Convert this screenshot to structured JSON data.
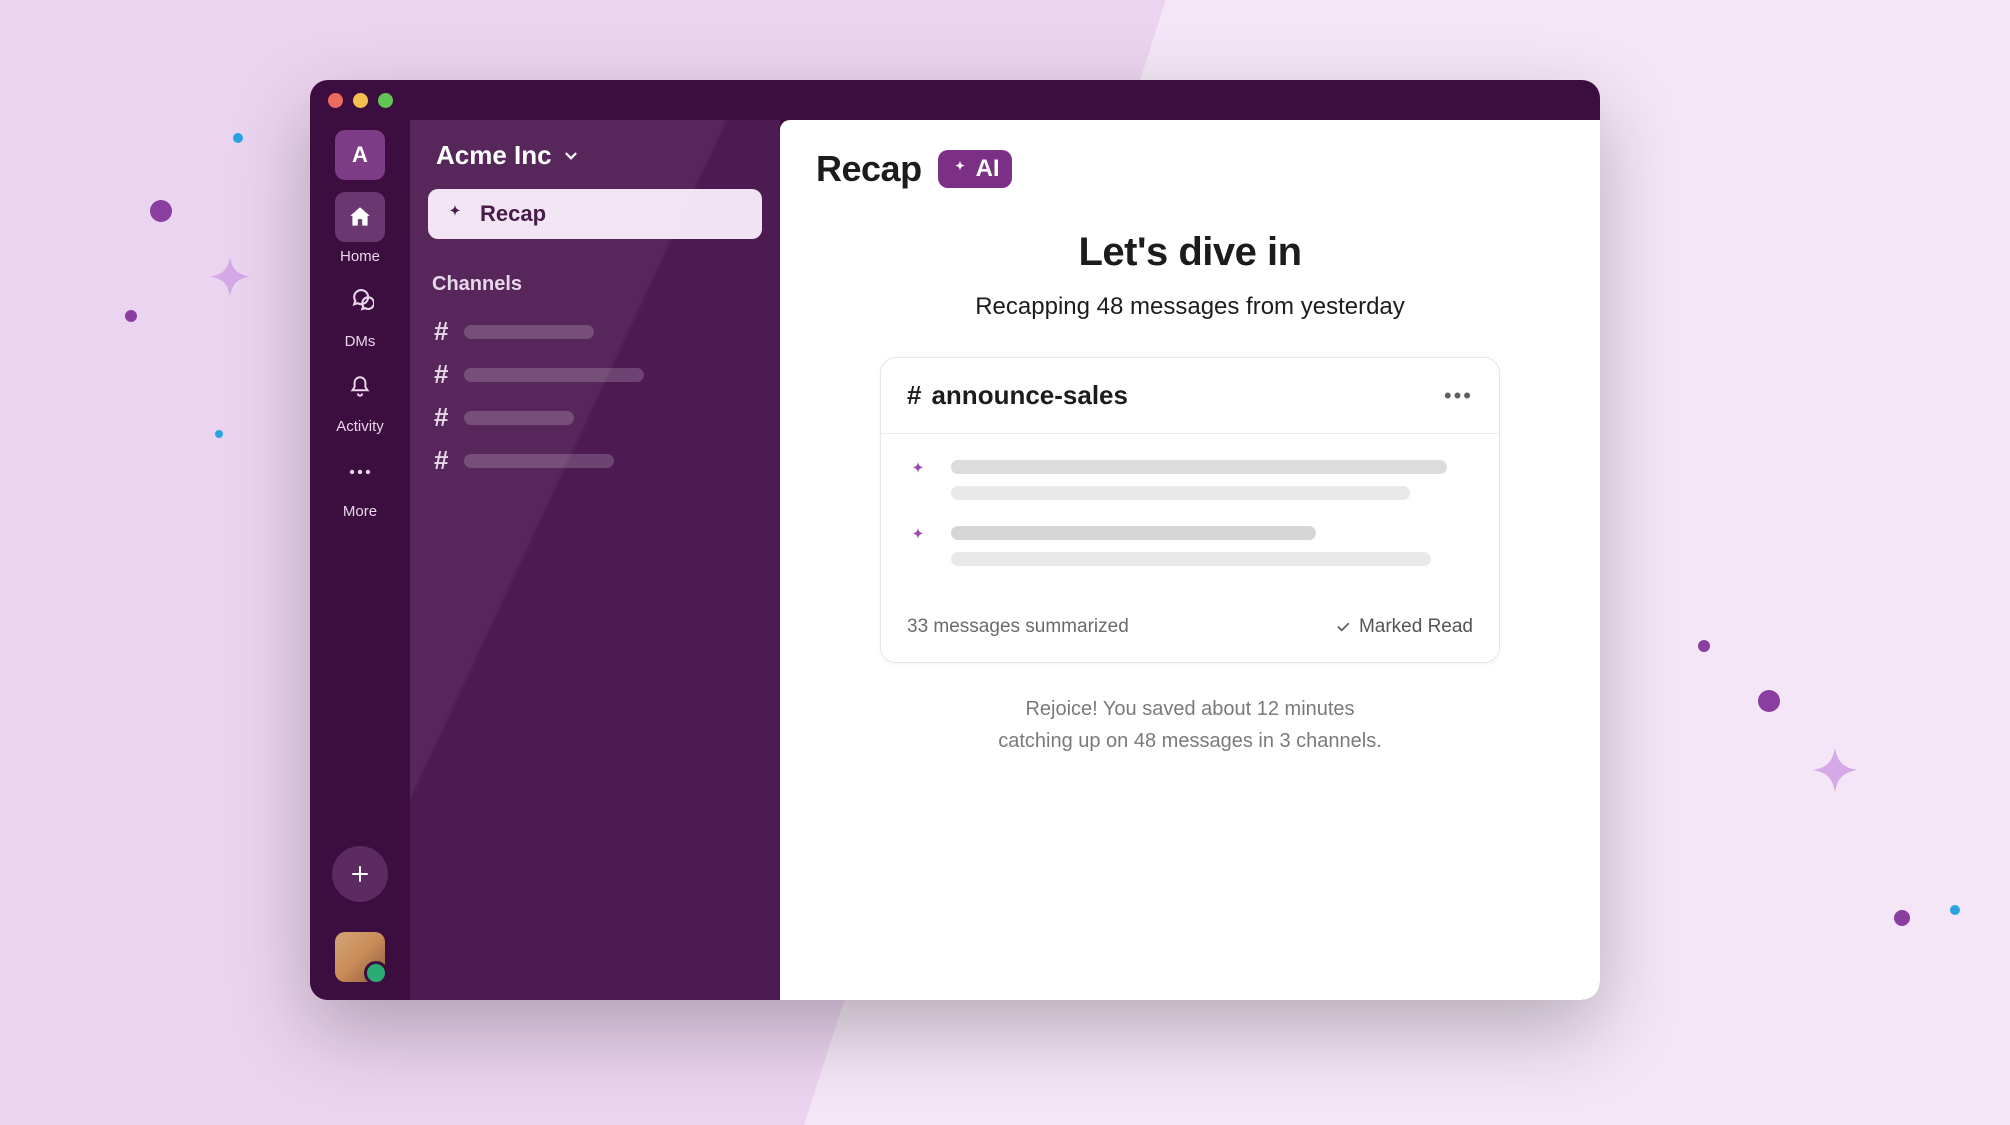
{
  "workspace": {
    "letter": "A",
    "name": "Acme Inc"
  },
  "rail": {
    "home": "Home",
    "dms": "DMs",
    "activity": "Activity",
    "more": "More"
  },
  "sidebar": {
    "recap_label": "Recap",
    "channels_header": "Channels"
  },
  "main": {
    "title": "Recap",
    "ai_badge": "AI",
    "hero_title": "Let's dive in",
    "hero_sub": "Recapping 48 messages from yesterday",
    "card": {
      "channel": "announce-sales",
      "summary_count": "33 messages summarized",
      "marked_read": "Marked Read"
    },
    "footer_line1": "Rejoice! You saved about 12 minutes",
    "footer_line2": "catching up on 48 messages in 3 channels."
  }
}
